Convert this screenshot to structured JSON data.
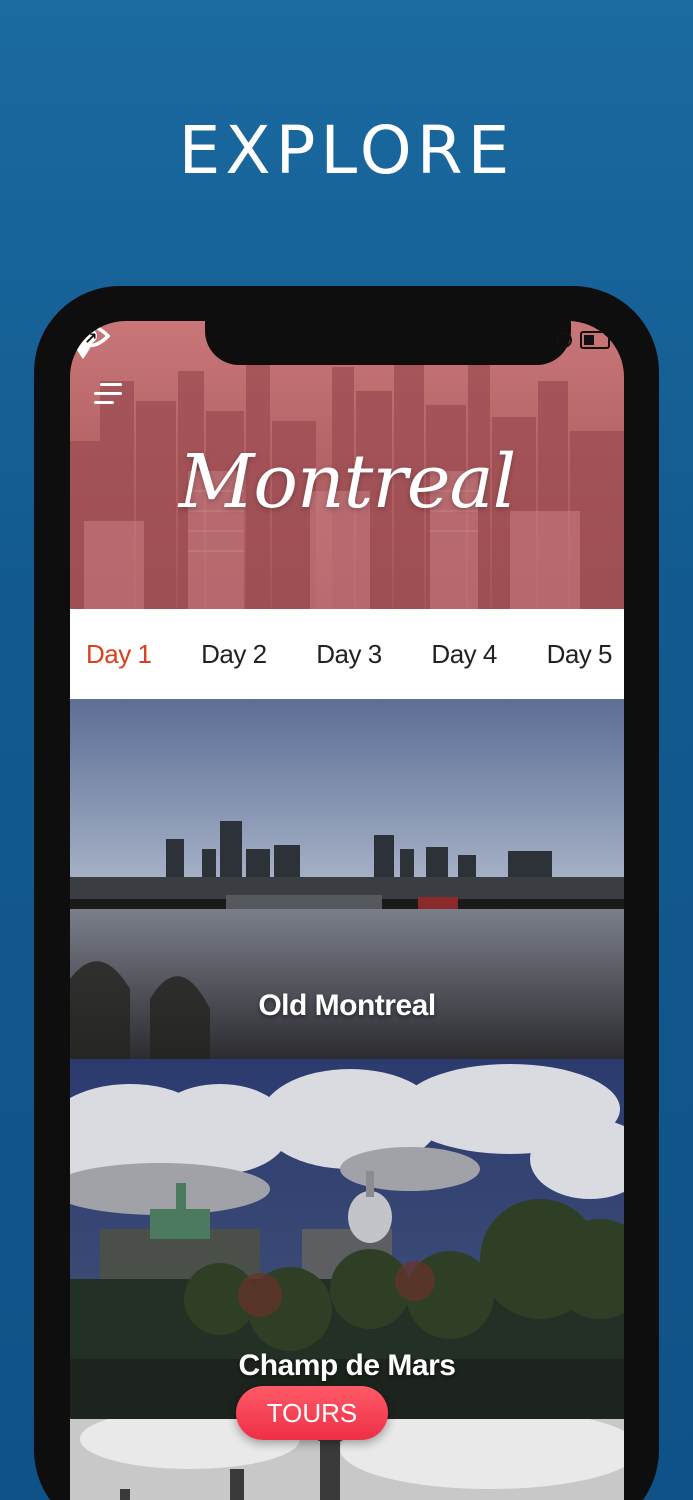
{
  "headline": "EXPLORE",
  "header": {
    "city_title": "Montreal",
    "menu_icon": "hamburger-menu-icon",
    "eye_icon": "eye-icon",
    "location_icon": "map-pin-icon"
  },
  "tabs": [
    {
      "label": "Day 1",
      "active": true
    },
    {
      "label": "Day 2",
      "active": false
    },
    {
      "label": "Day 3",
      "active": false
    },
    {
      "label": "Day 4",
      "active": false
    },
    {
      "label": "Day 5",
      "active": false
    }
  ],
  "places": [
    {
      "title": "Old Montreal"
    },
    {
      "title": "Champ de Mars"
    }
  ],
  "tours_button": "TOURS",
  "colors": {
    "background": "#125a8f",
    "hero_tint": "#b66566",
    "active_tab": "#d8401e",
    "tours_button": "#ee2f45"
  }
}
